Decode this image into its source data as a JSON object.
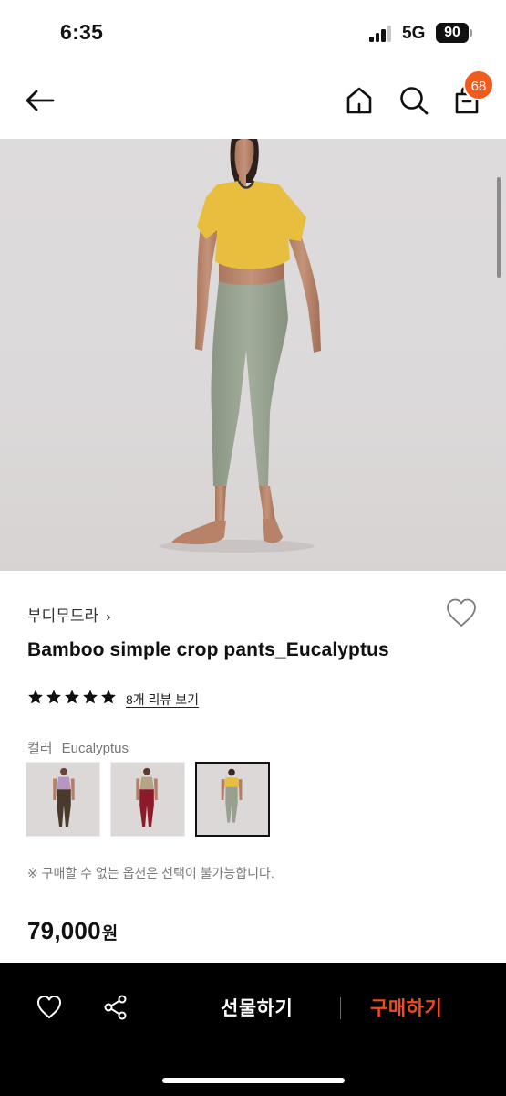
{
  "status_bar": {
    "time": "6:35",
    "network": "5G",
    "battery": "90"
  },
  "nav": {
    "cart_count": "68",
    "badge_color": "#f25b1c"
  },
  "product": {
    "brand": "부디무드라",
    "brand_chevron": "›",
    "title": "Bamboo simple crop pants_Eucalyptus",
    "rating_stars": 5,
    "review_link": "8개 리뷰 보기",
    "option_label": "컬러",
    "option_value": "Eucalyptus",
    "color_options": [
      {
        "name": "brown-with-lilac-top",
        "selected": false
      },
      {
        "name": "burgundy-with-tan-top",
        "selected": false
      },
      {
        "name": "eucalyptus-with-yellow-top",
        "selected": true
      }
    ],
    "notice": "※ 구매할 수 없는 옵션은 선택이 불가능합니다.",
    "price": "79,000",
    "price_unit": "원"
  },
  "bottom_bar": {
    "gift_label": "선물하기",
    "buy_label": "구매하기",
    "buy_color": "#f04a1e"
  }
}
